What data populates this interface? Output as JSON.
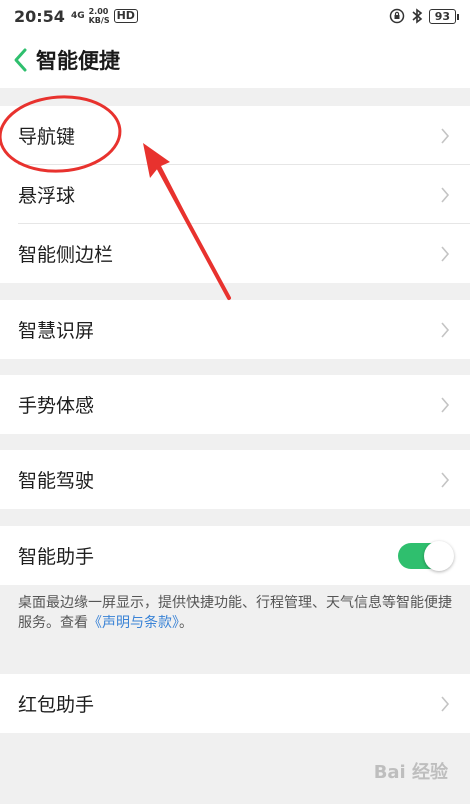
{
  "statusbar": {
    "time": "20:54",
    "signal": "4G",
    "net_speed": "2.00",
    "net_unit": "KB/S",
    "hd": "HD",
    "battery": "93"
  },
  "header": {
    "title": "智能便捷"
  },
  "items": {
    "nav_keys": "导航键",
    "float_ball": "悬浮球",
    "smart_sidebar": "智能侧边栏",
    "smart_screen": "智慧识屏",
    "gesture": "手势体感",
    "smart_driving": "智能驾驶",
    "smart_assistant": "智能助手",
    "red_packet": "红包助手"
  },
  "assistant_toggle_on": true,
  "description": {
    "text": "桌面最边缘一屏显示，提供快捷功能、行程管理、天气信息等智能便捷服务。查看",
    "link": "《声明与条款》",
    "suffix": "。"
  },
  "watermark": "Bai 经验",
  "colors": {
    "accent": "#2fbf6e",
    "link": "#3a83d6",
    "annotation": "#e8322e"
  }
}
